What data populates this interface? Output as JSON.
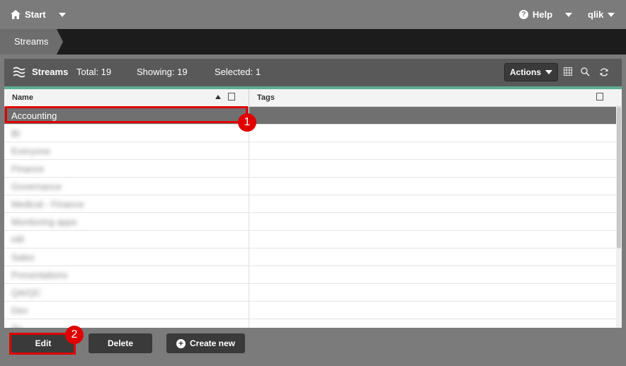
{
  "topbar": {
    "start_label": "Start",
    "help_label": "Help",
    "user_label": "qlik"
  },
  "breadcrumb": {
    "label": "Streams"
  },
  "panel": {
    "title": "Streams",
    "total": "Total: 19",
    "showing": "Showing: 19",
    "selected": "Selected: 1",
    "actions_label": "Actions"
  },
  "columns": {
    "name": "Name",
    "tags": "Tags"
  },
  "rows": [
    {
      "name": "Accounting",
      "selected": true
    },
    {
      "name": "BI"
    },
    {
      "name": "Everyone"
    },
    {
      "name": "Finance"
    },
    {
      "name": "Governance"
    },
    {
      "name": "Medical - Finance"
    },
    {
      "name": "Monitoring apps"
    },
    {
      "name": "HR"
    },
    {
      "name": "Sales"
    },
    {
      "name": "Presentations"
    },
    {
      "name": "QA/QC"
    },
    {
      "name": "Dev"
    },
    {
      "name": "Su"
    }
  ],
  "footer": {
    "edit_label": "Edit",
    "delete_label": "Delete",
    "create_label": "Create new"
  },
  "annotations": {
    "one": "1",
    "two": "2"
  },
  "colors": {
    "accent": "#5fae94",
    "highlight": "#e00000"
  }
}
